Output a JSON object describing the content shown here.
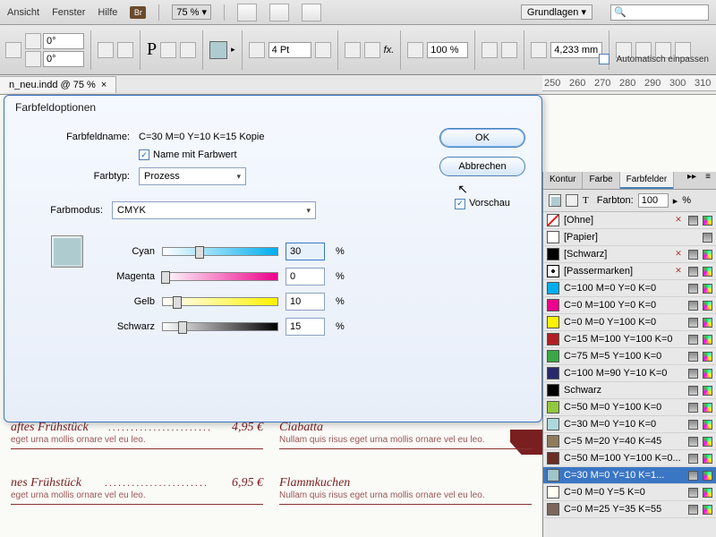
{
  "menu": {
    "ansicht": "Ansicht",
    "fenster": "Fenster",
    "hilfe": "Hilfe"
  },
  "top": {
    "br": "Br",
    "zoom": "75 %",
    "arrow": "▾",
    "workspace": "Grundlagen",
    "search_icon": "🔍"
  },
  "row2": {
    "angle": "0°",
    "pts": "4 Pt",
    "pct100": "100 %",
    "width": "4,233 mm",
    "autofit": "Automatisch einpassen"
  },
  "tab": "n_neu.indd @ 75 %",
  "tab_x": "×",
  "ruler": [
    "250",
    "260",
    "270",
    "280",
    "290",
    "300",
    "310"
  ],
  "dialog": {
    "title": "Farbfeldoptionen",
    "name_label": "Farbfeldname:",
    "name_value": "C=30 M=0 Y=10 K=15 Kopie",
    "name_with_val": "Name mit Farbwert",
    "type_label": "Farbtyp:",
    "type_value": "Prozess",
    "mode_label": "Farbmodus:",
    "mode_value": "CMYK",
    "ok": "OK",
    "cancel": "Abbrechen",
    "preview": "Vorschau",
    "sliders": {
      "cyan": {
        "label": "Cyan",
        "value": "30"
      },
      "magenta": {
        "label": "Magenta",
        "value": "0"
      },
      "yellow": {
        "label": "Gelb",
        "value": "10"
      },
      "black": {
        "label": "Schwarz",
        "value": "15"
      }
    },
    "pct": "%"
  },
  "doc": {
    "i1_name": "aftes Frühstück",
    "i1_price": "4,95 €",
    "i1_desc": "eget urna mollis ornare vel eu leo.",
    "i2_name": "Ciabatta",
    "i2_desc": "Nullam quis risus eget urna mollis ornare vel eu leo.",
    "i3_name": "nes Frühstück",
    "i3_price": "6,95 €",
    "i3_desc": "eget urna mollis ornare vel eu leo.",
    "i4_name": "Flammkuchen",
    "i4_desc": "Nullam quis risus eget urna mollis ornare vel eu leo.",
    "dots": "......................."
  },
  "panel": {
    "tabs": {
      "kontur": "Kontur",
      "farbe": "Farbe",
      "farbfelder": "Farbfelder"
    },
    "collapse": "▸▸",
    "menu": "≡",
    "t_label": "T",
    "tint_label": "Farbton:",
    "tint_value": "100",
    "tint_arrow": "▸",
    "tint_pct": "%"
  },
  "swatches": [
    {
      "name": "[Ohne]",
      "color": "none",
      "lock": true,
      "cross": true
    },
    {
      "name": "[Papier]",
      "color": "#ffffff"
    },
    {
      "name": "[Schwarz]",
      "color": "#000000",
      "lock": true,
      "cmyk": true
    },
    {
      "name": "[Passermarken]",
      "color": "reg",
      "lock": true,
      "target": true
    },
    {
      "name": "C=100 M=0 Y=0 K=0",
      "color": "#00aeef",
      "cmyk": true
    },
    {
      "name": "C=0 M=100 Y=0 K=0",
      "color": "#ec008c",
      "cmyk": true
    },
    {
      "name": "C=0 M=0 Y=100 K=0",
      "color": "#fff200",
      "cmyk": true
    },
    {
      "name": "C=15 M=100 Y=100 K=0",
      "color": "#b01f24",
      "cmyk": true
    },
    {
      "name": "C=75 M=5 Y=100 K=0",
      "color": "#39a845",
      "cmyk": true
    },
    {
      "name": "C=100 M=90 Y=10 K=0",
      "color": "#28296b",
      "cmyk": true
    },
    {
      "name": "Schwarz",
      "color": "#000000",
      "cmyk": true
    },
    {
      "name": "C=50 M=0 Y=100 K=0",
      "color": "#92c83e",
      "cmyk": true
    },
    {
      "name": "C=30 M=0 Y=10 K=0",
      "color": "#aed8de",
      "cmyk": true
    },
    {
      "name": "C=5 M=20 Y=40 K=45",
      "color": "#8e7a5c",
      "cmyk": true
    },
    {
      "name": "C=50 M=100 Y=100 K=0...",
      "color": "#6b2e25",
      "cmyk": true
    },
    {
      "name": "C=30 M=0 Y=10 K=1...",
      "color": "#a0c4c8",
      "cmyk": true,
      "selected": true
    },
    {
      "name": "C=0 M=0 Y=5 K=0",
      "color": "#fffef2",
      "cmyk": true
    },
    {
      "name": "C=0 M=25 Y=35 K=55",
      "color": "#7d675a",
      "cmyk": true
    }
  ]
}
